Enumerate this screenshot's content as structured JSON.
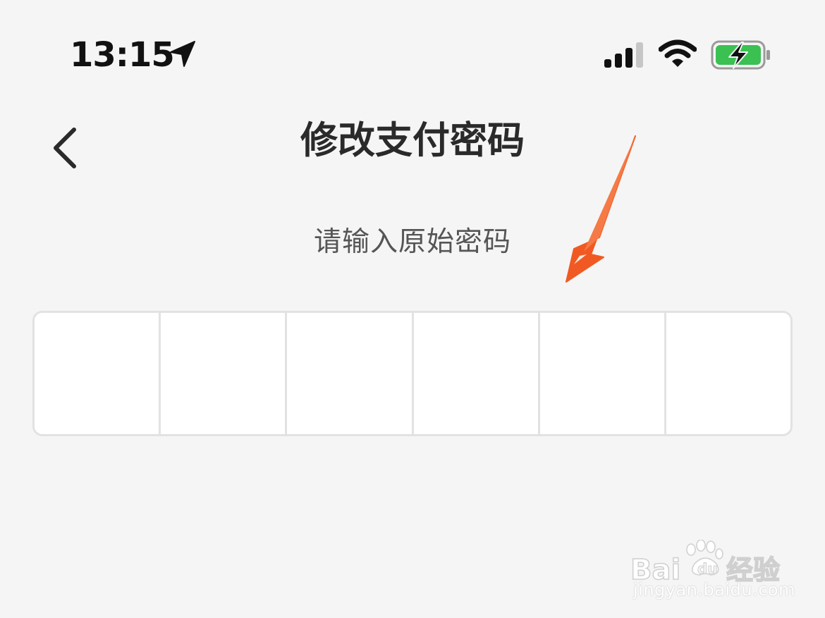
{
  "status_bar": {
    "time": "13:15",
    "location_icon": "location-arrow-icon",
    "signal_icon": "cellular-signal-icon",
    "wifi_icon": "wifi-icon",
    "battery_icon": "battery-charging-icon",
    "battery_color": "#3ac152"
  },
  "nav": {
    "back_icon": "chevron-left-icon",
    "title": "修改支付密码"
  },
  "prompt": "请输入原始密码",
  "pin_input": {
    "length": 6,
    "cells": [
      "",
      "",
      "",
      "",
      "",
      ""
    ]
  },
  "annotation": {
    "type": "arrow",
    "color": "#f05a22"
  },
  "watermark": {
    "brand": "Baidu经验",
    "url": "jingyan.baidu.com"
  }
}
